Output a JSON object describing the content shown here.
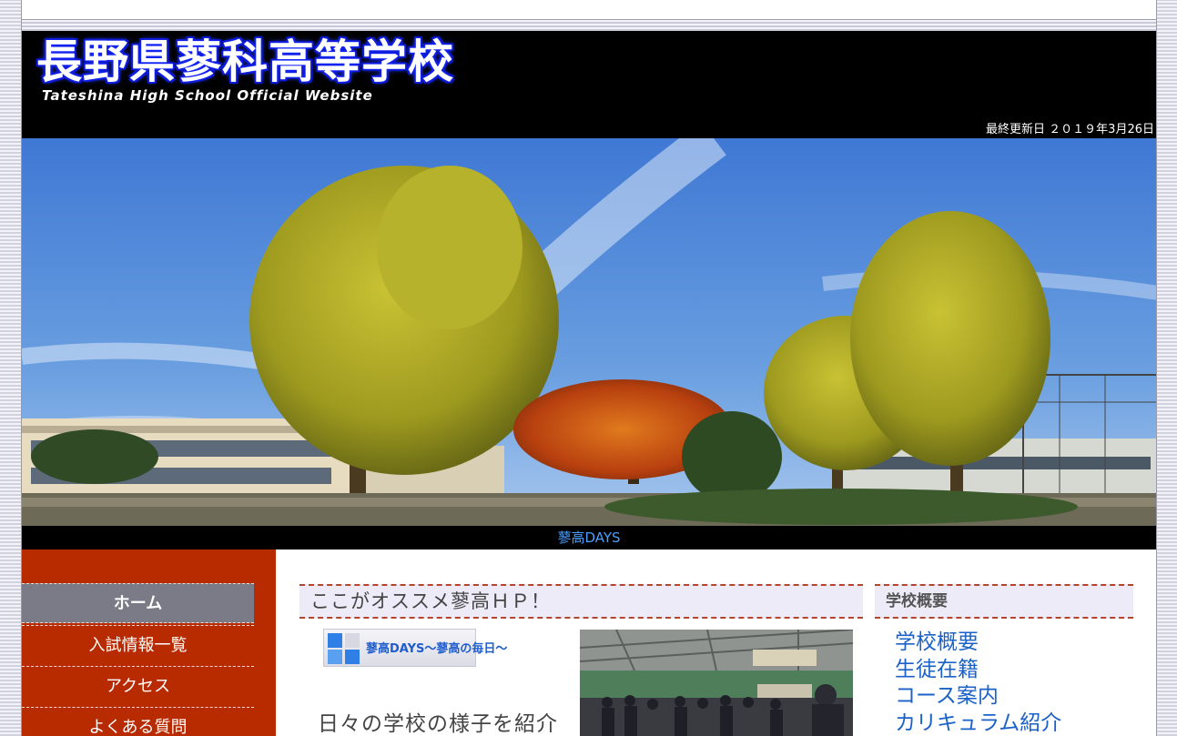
{
  "header": {
    "school_name": "長野県蓼科高等学校",
    "subtitle": "Tateshina High School Official Website",
    "last_updated": "最終更新日 ２０１９年3月26日"
  },
  "hero": {
    "caption": "蓼高DAYS"
  },
  "sidebar": {
    "items": [
      {
        "label": "ホーム",
        "active": true
      },
      {
        "label": "入試情報一覧"
      },
      {
        "label": "アクセス"
      },
      {
        "label": "よくある質問"
      }
    ]
  },
  "main": {
    "section_title": "ここがオススメ蓼高ＨＰ！",
    "banner_label": "蓼高DAYS～蓼高の毎日～",
    "intro_text": "日々の学校の様子を紹介"
  },
  "side_panel": {
    "title": "学校概要",
    "links": [
      "学校概要",
      "生徒在籍",
      "コース案内",
      "カリキュラム紹介"
    ]
  },
  "colors": {
    "sidebar_bg": "#b82b00",
    "active_nav_bg": "#7b7a87",
    "link_blue": "#1b62c8",
    "caption_blue": "#4a9fff",
    "header_bg": "#000000"
  },
  "icons": [
    "blue-squares-icon"
  ]
}
